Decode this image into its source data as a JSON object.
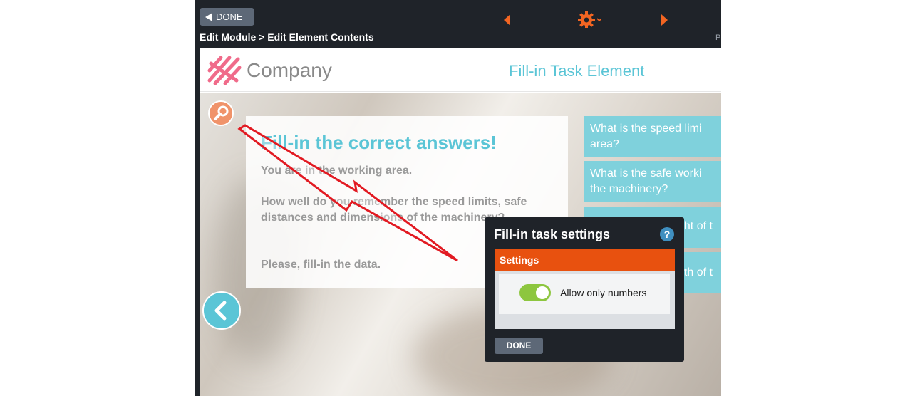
{
  "toolbar": {
    "done_label": "DONE",
    "breadcrumb": "Edit Module > Edit Element Contents",
    "right_edge_text": "P"
  },
  "header": {
    "company": "Company",
    "element_title": "Fill-in Task Element"
  },
  "task": {
    "title": "Fill-in the correct answers!",
    "line1": "You are in the working area.",
    "line2": "How well do you remember the speed limits, safe distances and dimensions of the machinery?",
    "line3": "Please, fill-in the data."
  },
  "questions": [
    {
      "line1": "What is the speed limi",
      "line2": "area?"
    },
    {
      "line1": "What is the safe worki",
      "line2": "the machinery?"
    },
    {
      "line1": "ght of t",
      "line2": ""
    },
    {
      "line1": "gth of t",
      "line2": ""
    }
  ],
  "dialog": {
    "title": "Fill-in task settings",
    "help": "?",
    "section": "Settings",
    "toggle_label": "Allow only numbers",
    "toggle_on": true,
    "done_label": "DONE"
  },
  "colors": {
    "accent_orange": "#e8510f",
    "teal": "#5bc5d6",
    "toggle_green": "#8dc63f",
    "logo_pink": "#f06b8a"
  },
  "icons": [
    "triangle-left-icon",
    "prev-arrow-icon",
    "gear-icon",
    "next-arrow-icon",
    "wrench-icon",
    "back-chevron-icon",
    "help-icon"
  ]
}
